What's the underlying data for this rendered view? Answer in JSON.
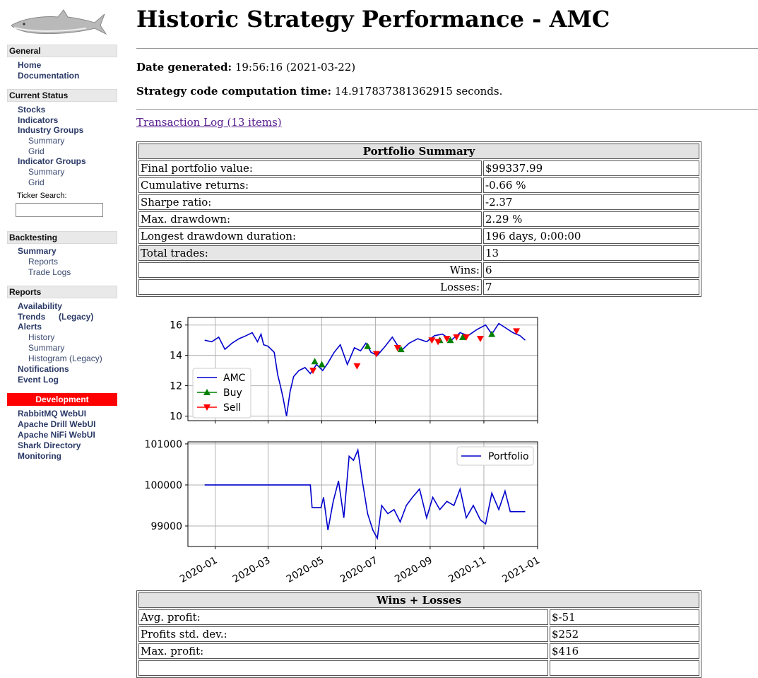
{
  "sidebar": {
    "general": {
      "heading": "General",
      "items": [
        {
          "label": "Home"
        },
        {
          "label": "Documentation"
        }
      ]
    },
    "current_status": {
      "heading": "Current Status",
      "stocks": "Stocks",
      "indicators": "Indicators",
      "industry_groups": "Industry Groups",
      "ig_summary": "Summary",
      "ig_grid": "Grid",
      "indicator_groups": "Indicator Groups",
      "indg_summary": "Summary",
      "indg_grid": "Grid",
      "ticker_label": "Ticker Search:",
      "ticker_value": ""
    },
    "backtesting": {
      "heading": "Backtesting",
      "summary": "Summary",
      "reports": "Reports",
      "trade_logs": "Trade Logs"
    },
    "reports": {
      "heading": "Reports",
      "availability": "Availability",
      "trends": "Trends",
      "legacy": "(Legacy)",
      "alerts": "Alerts",
      "history": "History",
      "summary": "Summary",
      "histogram": "Histogram (Legacy)",
      "notifications": "Notifications",
      "event_log": "Event Log"
    },
    "development": {
      "heading": "Development",
      "items": [
        {
          "label": "RabbitMQ WebUI"
        },
        {
          "label": "Apache Drill WebUI"
        },
        {
          "label": "Apache NiFi WebUI"
        },
        {
          "label": "Shark Directory"
        },
        {
          "label": "Monitoring"
        }
      ]
    }
  },
  "main": {
    "title": "Historic Strategy Performance - AMC",
    "date_label": "Date generated:",
    "date_value": "19:56:16 (2021-03-22)",
    "comp_label": "Strategy code computation time:",
    "comp_value": "14.917837381362915 seconds.",
    "tx_link": "Transaction Log (13 items)"
  },
  "portfolio_summary": {
    "heading": "Portfolio Summary",
    "rows": [
      {
        "label": "Final portfolio value:",
        "value": "$99337.99"
      },
      {
        "label": "Cumulative returns:",
        "value": "-0.66 %"
      },
      {
        "label": "Sharpe ratio:",
        "value": "-2.37"
      },
      {
        "label": "Max. drawdown:",
        "value": "2.29 %"
      },
      {
        "label": "Longest drawdown duration:",
        "value": "196 days, 0:00:00"
      },
      {
        "label": "Total trades:",
        "value": "13"
      },
      {
        "label": "Wins:",
        "value": "6"
      },
      {
        "label": "Losses:",
        "value": "7"
      }
    ]
  },
  "wins_losses": {
    "heading": "Wins + Losses",
    "rows": [
      {
        "label": "Avg. profit:",
        "value": "$-51"
      },
      {
        "label": "Profits std. dev.:",
        "value": "$252"
      },
      {
        "label": "Max. profit:",
        "value": "$416"
      }
    ]
  },
  "colors": {
    "line": "#0000cc",
    "buy": "#008000",
    "sell": "#ff0000",
    "dev_bar": "#ff0000"
  },
  "chart_data": [
    {
      "type": "line",
      "title": "",
      "ylim": [
        9.7,
        16.5
      ],
      "yticks": [
        10,
        12,
        14,
        16
      ],
      "grid": true,
      "legend": "lower-left",
      "legend_entries": [
        "AMC",
        "Buy",
        "Sell"
      ],
      "x_labels": [
        "2020-01",
        "2020-03",
        "2020-05",
        "2020-07",
        "2020-09",
        "2020-11",
        "2021-01"
      ],
      "series": [
        {
          "name": "AMC",
          "x": [
            "2019-12-20",
            "2019-12-28",
            "2020-01-05",
            "2020-01-12",
            "2020-01-20",
            "2020-01-28",
            "2020-02-05",
            "2020-02-12",
            "2020-02-18",
            "2020-02-22",
            "2020-02-25",
            "2020-03-01",
            "2020-03-08",
            "2020-03-12",
            "2020-03-15",
            "2020-03-18",
            "2020-03-22",
            "2020-03-26",
            "2020-03-30",
            "2020-04-05",
            "2020-04-12",
            "2020-04-18",
            "2020-04-25",
            "2020-05-02",
            "2020-05-08",
            "2020-05-15",
            "2020-05-22",
            "2020-05-30",
            "2020-06-07",
            "2020-06-14",
            "2020-06-20",
            "2020-06-26",
            "2020-07-03",
            "2020-07-12",
            "2020-07-20",
            "2020-07-30",
            "2020-08-08",
            "2020-08-18",
            "2020-08-28",
            "2020-09-06",
            "2020-09-15",
            "2020-09-25",
            "2020-10-05",
            "2020-10-14",
            "2020-10-24",
            "2020-11-03",
            "2020-11-10",
            "2020-11-18",
            "2020-11-26",
            "2020-12-04",
            "2020-12-12",
            "2020-12-18"
          ],
          "y": [
            15.0,
            14.9,
            15.2,
            14.4,
            14.8,
            15.1,
            15.3,
            15.5,
            14.9,
            15.4,
            14.7,
            14.6,
            14.2,
            12.7,
            12.0,
            11.2,
            10.0,
            11.6,
            12.6,
            13.0,
            13.2,
            12.8,
            13.4,
            13.0,
            13.5,
            14.2,
            14.7,
            13.4,
            14.5,
            14.3,
            14.8,
            14.2,
            14.0,
            14.6,
            15.2,
            14.3,
            14.8,
            15.1,
            14.9,
            15.3,
            15.4,
            15.0,
            15.5,
            15.3,
            15.7,
            16.0,
            15.4,
            16.1,
            15.8,
            15.5,
            15.3,
            15.0
          ]
        },
        {
          "name": "Buy",
          "x": [
            "2020-04-23",
            "2020-05-01",
            "2020-06-22",
            "2020-07-30",
            "2020-09-12",
            "2020-09-24",
            "2020-10-08",
            "2020-11-10"
          ],
          "y": [
            13.6,
            13.4,
            14.6,
            14.4,
            15.0,
            15.0,
            15.2,
            15.4
          ]
        },
        {
          "name": "Sell",
          "x": [
            "2020-04-21",
            "2020-06-10",
            "2020-07-02",
            "2020-07-26",
            "2020-09-03",
            "2020-09-10",
            "2020-09-20",
            "2020-10-01",
            "2020-10-12",
            "2020-10-28",
            "2020-12-08"
          ],
          "y": [
            13.0,
            13.3,
            14.1,
            14.5,
            15.0,
            14.9,
            15.1,
            15.2,
            15.2,
            15.1,
            15.6
          ]
        }
      ]
    },
    {
      "type": "line",
      "title": "",
      "ylim": [
        98500,
        101050
      ],
      "yticks": [
        99000,
        100000,
        101000
      ],
      "grid": true,
      "legend": "top-right",
      "legend_entries": [
        "Portfolio"
      ],
      "x_labels": [
        "2020-01",
        "2020-03",
        "2020-05",
        "2020-07",
        "2020-09",
        "2020-11",
        "2021-01"
      ],
      "series": [
        {
          "name": "Portfolio",
          "x": [
            "2019-12-20",
            "2020-02-15",
            "2020-04-18",
            "2020-04-20",
            "2020-04-30",
            "2020-05-03",
            "2020-05-08",
            "2020-05-14",
            "2020-05-20",
            "2020-05-26",
            "2020-06-01",
            "2020-06-06",
            "2020-06-11",
            "2020-06-16",
            "2020-06-22",
            "2020-06-28",
            "2020-07-03",
            "2020-07-08",
            "2020-07-15",
            "2020-07-22",
            "2020-07-29",
            "2020-08-05",
            "2020-08-12",
            "2020-08-20",
            "2020-08-28",
            "2020-09-04",
            "2020-09-12",
            "2020-09-20",
            "2020-09-28",
            "2020-10-05",
            "2020-10-12",
            "2020-10-20",
            "2020-10-28",
            "2020-11-03",
            "2020-11-10",
            "2020-11-18",
            "2020-11-25",
            "2020-12-01",
            "2020-12-18"
          ],
          "y": [
            100000,
            100000,
            100000,
            99450,
            99450,
            99700,
            98900,
            99600,
            100100,
            99200,
            100700,
            100600,
            100850,
            100100,
            99300,
            98900,
            98700,
            99500,
            99300,
            99400,
            99100,
            99500,
            99700,
            99900,
            99200,
            99700,
            99400,
            99600,
            99500,
            99900,
            99200,
            99500,
            99150,
            99050,
            99800,
            99400,
            99850,
            99350,
            99350
          ]
        }
      ]
    }
  ]
}
